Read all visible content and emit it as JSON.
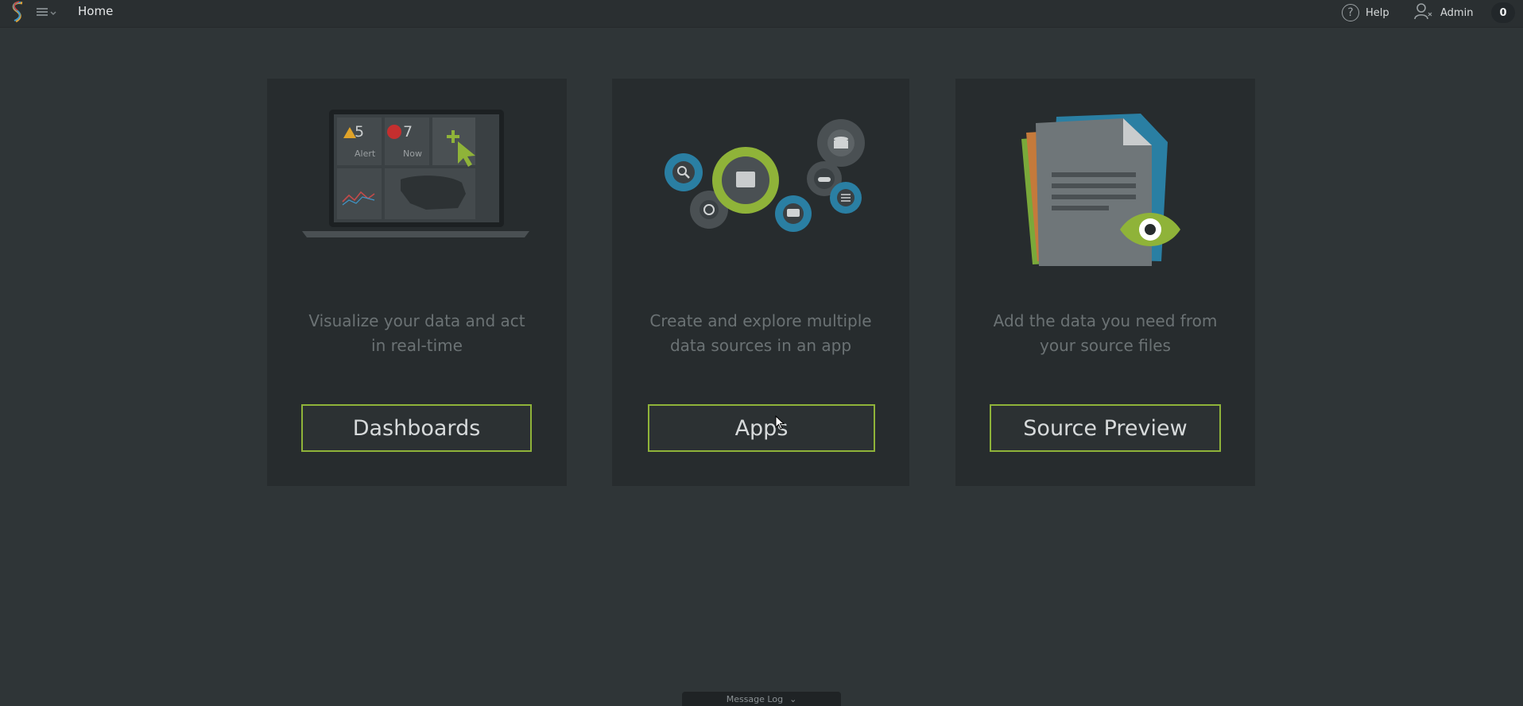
{
  "topbar": {
    "home_label": "Home",
    "help_label": "Help",
    "help_glyph": "?",
    "admin_label": "Admin",
    "notification_count": "0"
  },
  "cards": [
    {
      "description_line1": "Visualize your data and act",
      "description_line2": "in real-time",
      "button_label": "Dashboards",
      "illustration": {
        "alert_count": "5",
        "alert_label": "Alert",
        "now_count": "7",
        "now_label": "Now"
      }
    },
    {
      "description_line1": "Create and explore multiple",
      "description_line2": "data sources in an app",
      "button_label": "Apps"
    },
    {
      "description_line1": "Add the data you need from",
      "description_line2": "your source files",
      "button_label": "Source Preview"
    }
  ],
  "message_log": {
    "label": "Message Log",
    "chevron": "⌄"
  },
  "colors": {
    "accent_green": "#8fb339",
    "background": "#2f3537",
    "card": "#272c2e",
    "gear_blue": "#2a7fa3"
  }
}
